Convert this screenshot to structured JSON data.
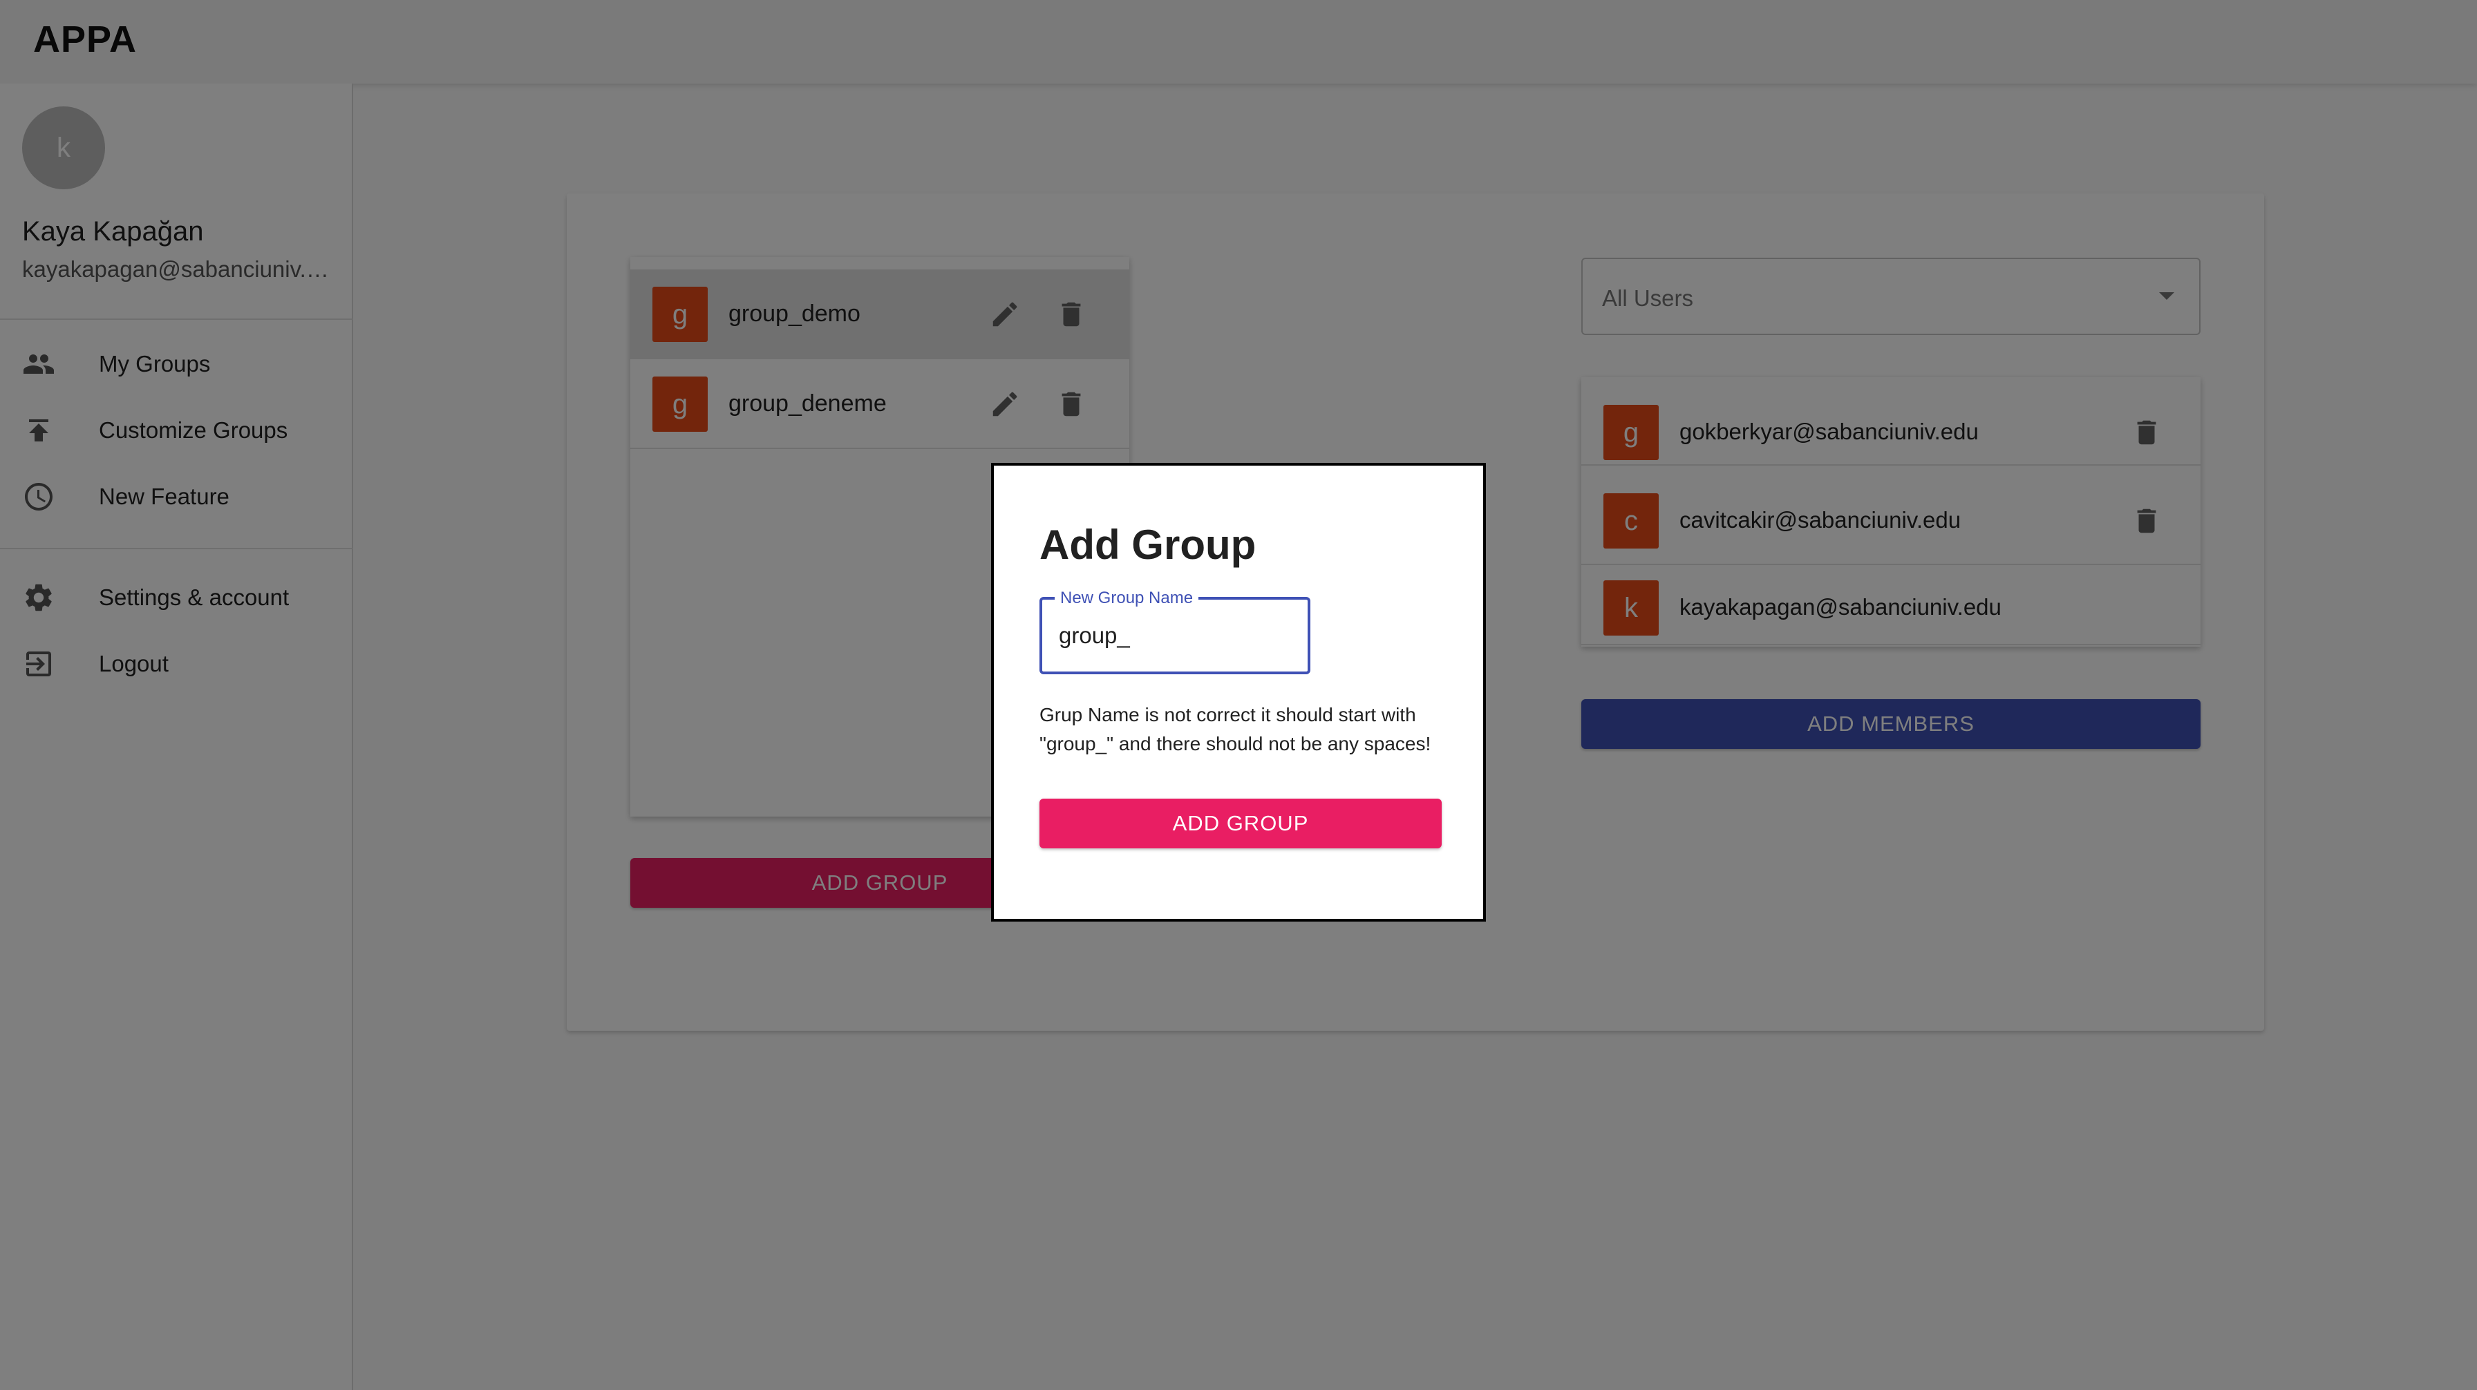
{
  "app": {
    "title": "APPA"
  },
  "user": {
    "avatar_letter": "k",
    "name": "Kaya Kapağan",
    "email": "kayakapagan@sabanciuniv.edu"
  },
  "nav": {
    "items": [
      {
        "label": "My Groups",
        "icon": "people-icon"
      },
      {
        "label": "Customize Groups",
        "icon": "upload-icon"
      },
      {
        "label": "New Feature",
        "icon": "clock-icon"
      }
    ],
    "secondary": [
      {
        "label": "Settings & account",
        "icon": "gear-icon"
      },
      {
        "label": "Logout",
        "icon": "logout-icon"
      }
    ]
  },
  "groups": [
    {
      "letter": "g",
      "name": "group_demo"
    },
    {
      "letter": "g",
      "name": "group_deneme"
    }
  ],
  "add_group_label": "ADD GROUP",
  "user_filter": {
    "selected": "All Users"
  },
  "members": [
    {
      "letter": "g",
      "email": "gokberkyar@sabanciuniv.edu"
    },
    {
      "letter": "c",
      "email": "cavitcakir@sabanciuniv.edu"
    },
    {
      "letter": "k",
      "email": "kayakapagan@sabanciuniv.edu"
    }
  ],
  "add_members_label": "ADD MEMBERS",
  "dialog": {
    "title": "Add Group",
    "field_label": "New Group Name",
    "field_value": "group_",
    "error": "Grup Name is not correct it should start with \"group_\" and there should not be any spaces!",
    "submit_label": "ADD GROUP"
  },
  "colors": {
    "avatar": "#e64a19",
    "primary": "#3f51b5",
    "secondary": "#e91e63"
  }
}
